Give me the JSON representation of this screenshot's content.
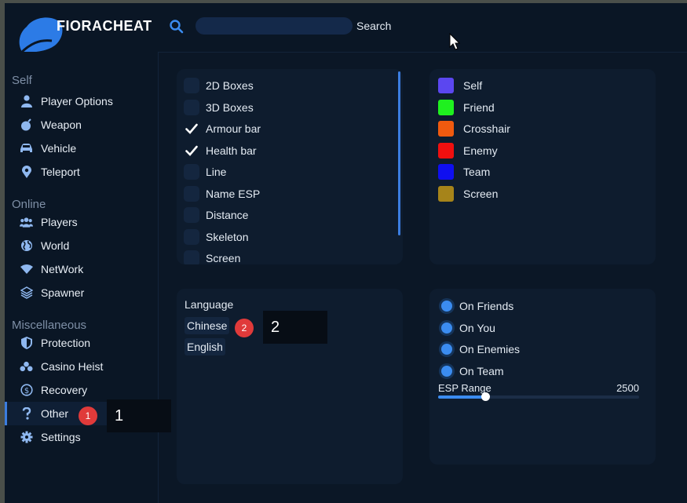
{
  "header": {
    "brand": "FIORACHEAT",
    "search_placeholder": "",
    "search_value": "",
    "search_label": "Search"
  },
  "sidebar": {
    "sections": [
      {
        "title": "Self",
        "items": [
          {
            "label": "Player Options",
            "icon": "user-icon"
          },
          {
            "label": "Weapon",
            "icon": "bomb-icon"
          },
          {
            "label": "Vehicle",
            "icon": "car-icon"
          },
          {
            "label": "Teleport",
            "icon": "map-pin-icon"
          }
        ]
      },
      {
        "title": "Online",
        "items": [
          {
            "label": "Players",
            "icon": "users-icon"
          },
          {
            "label": "World",
            "icon": "globe-icon"
          },
          {
            "label": "NetWork",
            "icon": "wifi-icon"
          },
          {
            "label": "Spawner",
            "icon": "layers-icon"
          }
        ]
      },
      {
        "title": "Miscellaneous",
        "items": [
          {
            "label": "Protection",
            "icon": "shield-icon"
          },
          {
            "label": "Casino Heist",
            "icon": "coins-icon"
          },
          {
            "label": "Recovery",
            "icon": "dollar-circle-icon"
          },
          {
            "label": "Other",
            "icon": "question-icon",
            "active": true
          },
          {
            "label": "Settings",
            "icon": "gear-icon"
          }
        ]
      }
    ]
  },
  "esp_options": [
    {
      "label": "2D Boxes",
      "checked": false
    },
    {
      "label": "3D Boxes",
      "checked": false
    },
    {
      "label": "Armour bar",
      "checked": true
    },
    {
      "label": "Health bar",
      "checked": true
    },
    {
      "label": "Line",
      "checked": false
    },
    {
      "label": "Name ESP",
      "checked": false
    },
    {
      "label": "Distance",
      "checked": false
    },
    {
      "label": "Skeleton",
      "checked": false
    },
    {
      "label": "Screen",
      "checked": false
    }
  ],
  "colors": [
    {
      "label": "Self",
      "color": "#5b47f0"
    },
    {
      "label": "Friend",
      "color": "#1ff01f"
    },
    {
      "label": "Crosshair",
      "color": "#f05a0f"
    },
    {
      "label": "Enemy",
      "color": "#f00f0f"
    },
    {
      "label": "Team",
      "color": "#0f0ff0"
    },
    {
      "label": "Screen",
      "color": "#a6841a"
    }
  ],
  "language": {
    "title": "Language",
    "options": [
      "Chinese",
      "English"
    ]
  },
  "radios": [
    {
      "label": "On Friends"
    },
    {
      "label": "On You"
    },
    {
      "label": "On Enemies"
    },
    {
      "label": "On Team"
    }
  ],
  "esp_range": {
    "label": "ESP Range",
    "value": "2500",
    "fraction": 0.24
  },
  "annotations": [
    {
      "badge": "1",
      "callout": "1"
    },
    {
      "badge": "2",
      "callout": "2"
    }
  ],
  "theme": {
    "accent": "#3b7de0",
    "badge": "#e03a3a"
  }
}
